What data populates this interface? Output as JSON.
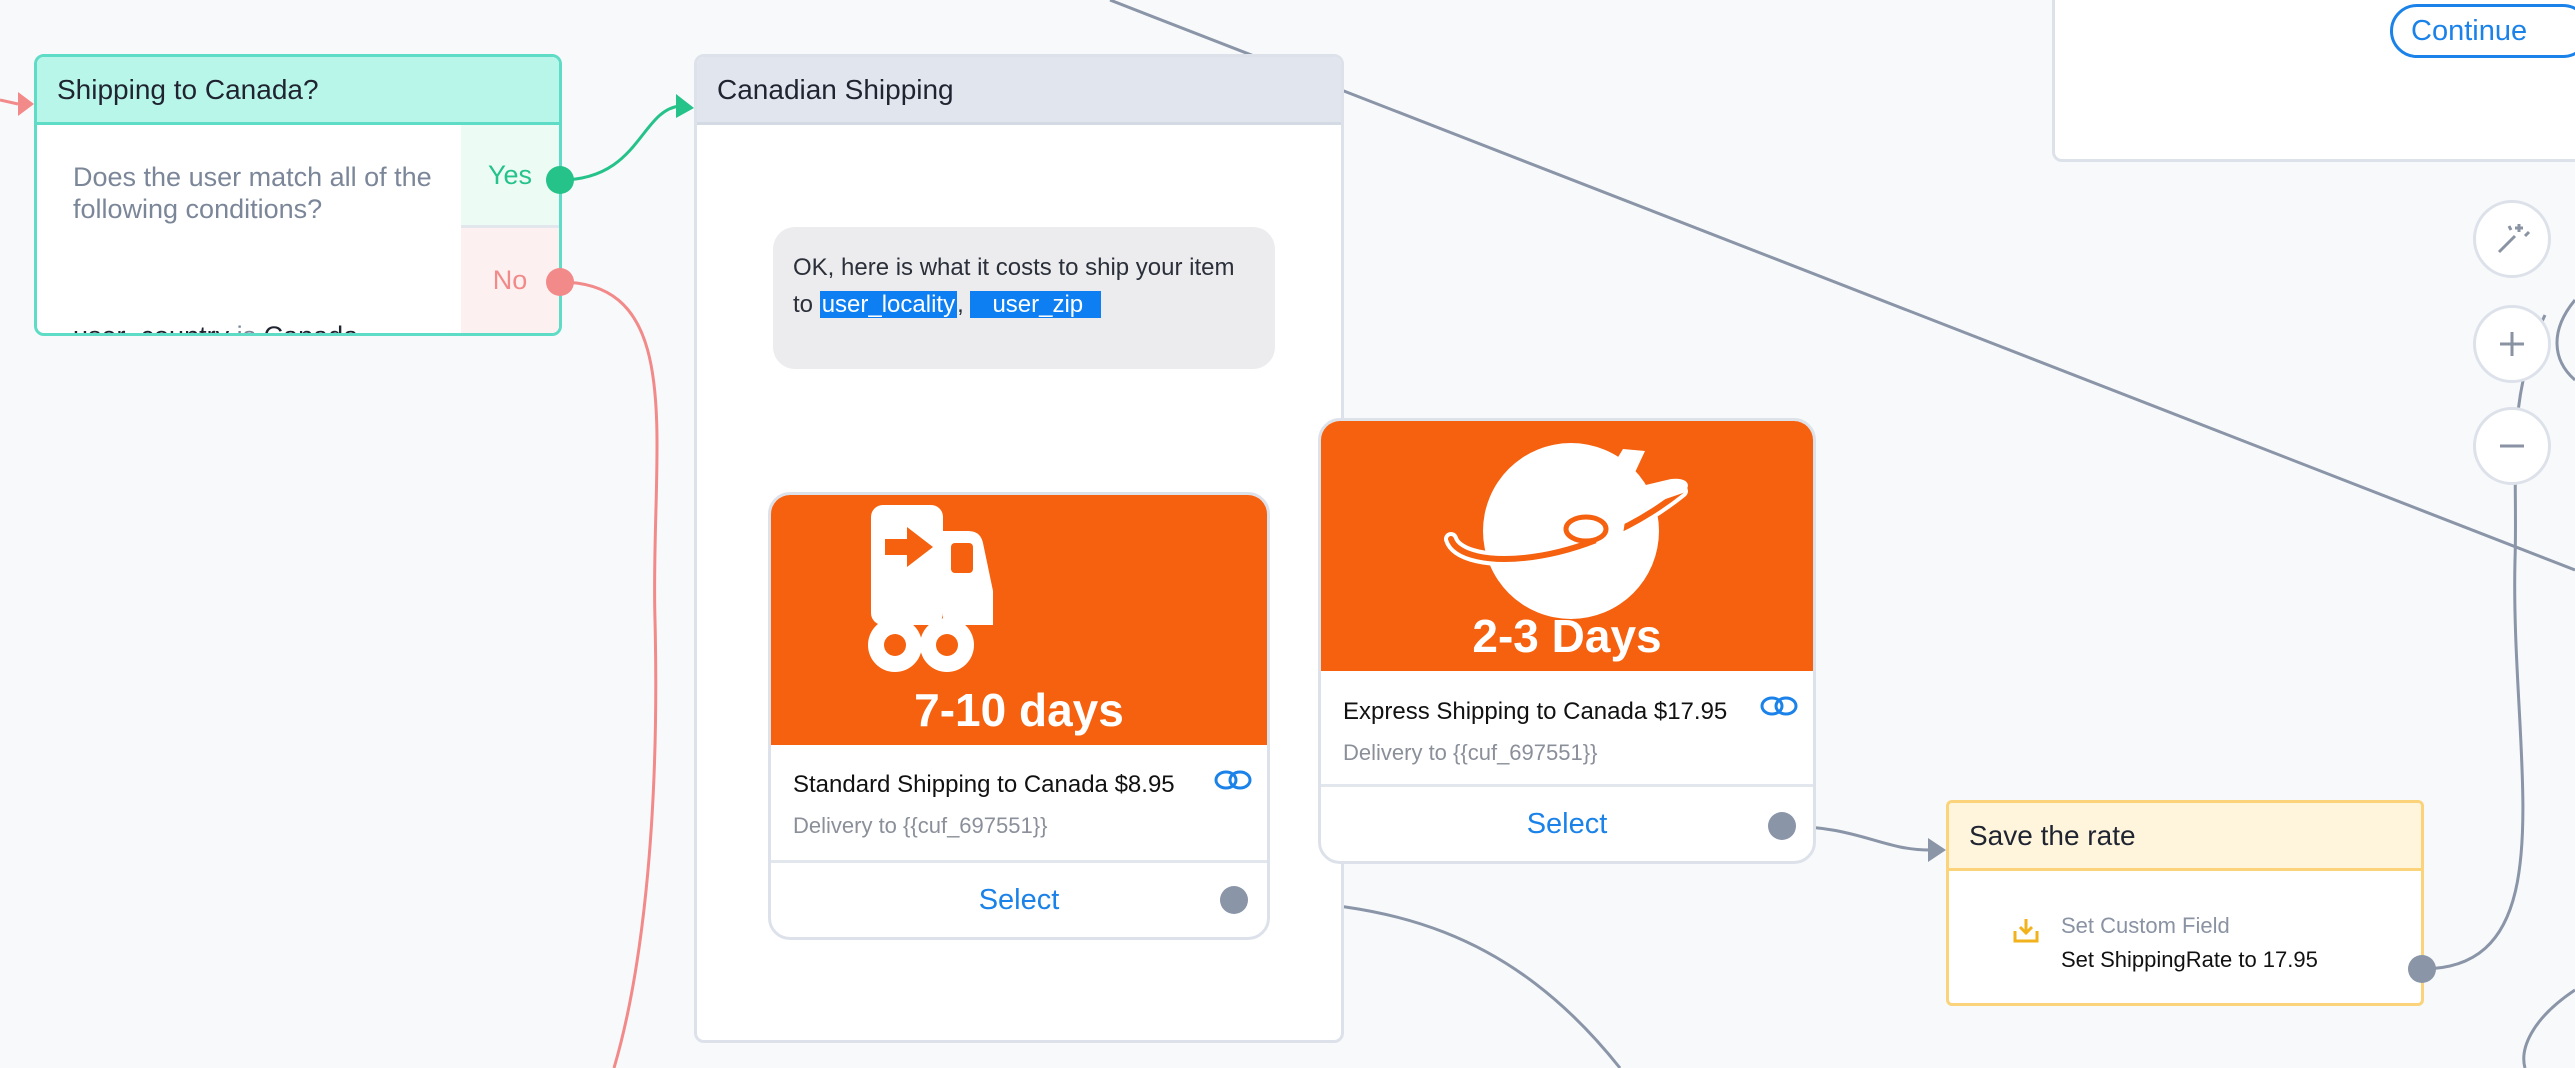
{
  "condition_node": {
    "title": "Shipping to Canada?",
    "question": "Does the user match all of the following conditions?",
    "rule_field": "user_country",
    "rule_operator": "is",
    "rule_value": "Canada",
    "yes_label": "Yes",
    "no_label": "No"
  },
  "message_node": {
    "title": "Canadian Shipping",
    "text_prefix": "OK, here is what it costs to ship your item to",
    "var_locality": "user_locality",
    "separator": ",",
    "var_zip": "user_zip",
    "cards": [
      {
        "image_caption": "7-10 days",
        "image_icon": "truck-icon",
        "title": "Standard Shipping to Canada $8.95",
        "subtitle": "Delivery to {{cuf_697551}}",
        "button_label": "Select"
      },
      {
        "image_caption": "2-3 Days",
        "image_icon": "airplane-globe-icon",
        "title": "Express Shipping to Canada $17.95",
        "subtitle": "Delivery to {{cuf_697551}}",
        "button_label": "Select"
      }
    ]
  },
  "action_node": {
    "title": "Save the rate",
    "action_type": "Set Custom Field",
    "action_detail": "Set ShippingRate to 17.95"
  },
  "top_panel": {
    "continue_label": "Continue"
  },
  "colors": {
    "accent_blue": "#1a82e8",
    "brand_orange": "#f5610e",
    "yes_green": "#25c28a",
    "no_red": "#f28a8a",
    "connector_gray": "#8a95a8"
  }
}
